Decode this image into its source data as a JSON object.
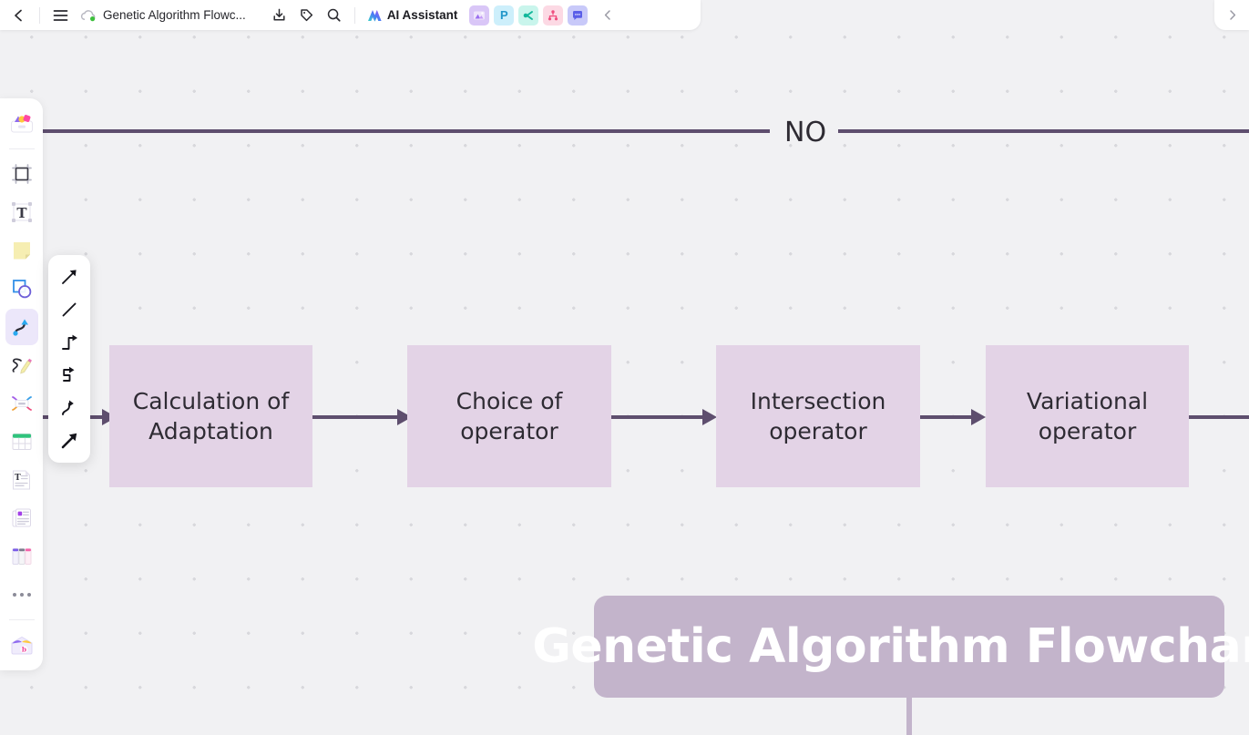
{
  "topbar": {
    "back_icon": "chevron-left-icon",
    "menu_icon": "hamburger-menu-icon",
    "cloud_icon": "cloud-sync-icon",
    "doc_title": "Genetic Algorithm Flowc...",
    "download_icon": "download-icon",
    "tag_icon": "tag-icon",
    "search_icon": "search-icon",
    "ai_label": "AI Assistant",
    "ai_icon": "ai-sparkle-icon",
    "collapse_icon": "chevron-left-icon",
    "apps": [
      {
        "name": "image-app-icon",
        "glyph": "▲",
        "bg": "#d9c6f7",
        "fg": "#9b6ef0"
      },
      {
        "name": "presentation-app-icon",
        "glyph": "P",
        "bg": "#cdeffb",
        "fg": "#2196c9"
      },
      {
        "name": "mindmap-app-icon",
        "glyph": "C",
        "bg": "#c9f5ec",
        "fg": "#17b89a"
      },
      {
        "name": "orgchart-app-icon",
        "glyph": "⑂",
        "bg": "#fcd9e4",
        "fg": "#ef4d7e"
      },
      {
        "name": "chat-app-icon",
        "glyph": "■",
        "bg": "#c8c9f9",
        "fg": "#6366e8"
      }
    ]
  },
  "right_panel": {
    "expand_icon": "chevron-right-icon"
  },
  "tool_rail": {
    "items": [
      {
        "name": "shapes-library-icon",
        "label": "Shapes library",
        "active": false
      },
      {
        "name": "frame-tool-icon",
        "label": "Frame",
        "active": false
      },
      {
        "name": "text-tool-icon",
        "label": "Text",
        "active": false
      },
      {
        "name": "sticky-note-tool-icon",
        "label": "Sticky note",
        "active": false
      },
      {
        "name": "shape-tool-icon",
        "label": "Shape",
        "active": false
      },
      {
        "name": "connector-tool-icon",
        "label": "Connector",
        "active": true
      },
      {
        "name": "pen-tool-icon",
        "label": "Pen",
        "active": false
      },
      {
        "name": "mindmap-tool-icon",
        "label": "Mind map",
        "active": false
      },
      {
        "name": "table-tool-icon",
        "label": "Table",
        "active": false
      },
      {
        "name": "textbox-tool-icon",
        "label": "Text box",
        "active": false
      },
      {
        "name": "card-tool-icon",
        "label": "Card",
        "active": false
      },
      {
        "name": "kanban-tool-icon",
        "label": "Kanban",
        "active": false
      },
      {
        "name": "more-tools-icon",
        "label": "More",
        "active": false
      },
      {
        "name": "templates-tool-icon",
        "label": "Templates",
        "active": false
      }
    ]
  },
  "connector_flyout": {
    "options": [
      {
        "name": "straight-arrow-connector-icon",
        "label": "Straight arrow"
      },
      {
        "name": "plain-line-connector-icon",
        "label": "Line"
      },
      {
        "name": "elbow-arrow-connector-icon",
        "label": "Elbow arrow"
      },
      {
        "name": "s-step-arrow-connector-icon",
        "label": "S-shaped step arrow"
      },
      {
        "name": "curved-arrow-connector-icon",
        "label": "Curved arrow"
      },
      {
        "name": "bold-arrow-connector-icon",
        "label": "Bold arrow"
      }
    ]
  },
  "canvas": {
    "branch_label": "NO",
    "nodes": [
      {
        "id": "calculation-of-adaptation",
        "text": "Calculation of\nAdaptation"
      },
      {
        "id": "choice-of-operator",
        "text": "Choice of\noperator"
      },
      {
        "id": "intersection-operator",
        "text": "Intersection\noperator"
      },
      {
        "id": "variational-operator",
        "text": "Variational\noperator"
      }
    ],
    "banner_title": "Genetic Algorithm Flowchart",
    "colors": {
      "node_fill": "#e3d3e6",
      "connector": "#5e4e6e",
      "banner_fill": "#c3b4cb",
      "banner_text": "#ffffff",
      "canvas_bg": "#f1f1f3"
    }
  }
}
